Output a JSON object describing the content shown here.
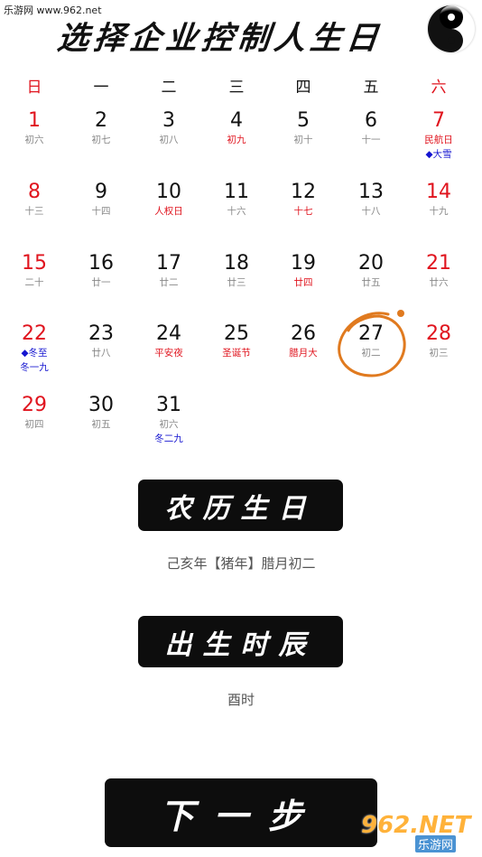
{
  "watermark_top": "乐游网 www.962.net",
  "title": "选择企业控制人生日",
  "weekdays": [
    {
      "label": "日",
      "color": "red"
    },
    {
      "label": "一",
      "color": "black"
    },
    {
      "label": "二",
      "color": "black"
    },
    {
      "label": "三",
      "color": "black"
    },
    {
      "label": "四",
      "color": "black"
    },
    {
      "label": "五",
      "color": "black"
    },
    {
      "label": "六",
      "color": "red"
    }
  ],
  "days": [
    {
      "day": "1",
      "lunar": "初六",
      "lunar_color": "gray",
      "weekend": true
    },
    {
      "day": "2",
      "lunar": "初七",
      "lunar_color": "gray"
    },
    {
      "day": "3",
      "lunar": "初八",
      "lunar_color": "gray"
    },
    {
      "day": "4",
      "lunar": "初九",
      "lunar_color": "red"
    },
    {
      "day": "5",
      "lunar": "初十",
      "lunar_color": "gray"
    },
    {
      "day": "6",
      "lunar": "十一",
      "lunar_color": "gray"
    },
    {
      "day": "7",
      "lunar": "民航日",
      "lunar_color": "red",
      "extra": "◆大雪",
      "extra_color": "blue",
      "weekend": true
    },
    {
      "day": "8",
      "lunar": "十三",
      "lunar_color": "gray",
      "weekend": true
    },
    {
      "day": "9",
      "lunar": "十四",
      "lunar_color": "gray"
    },
    {
      "day": "10",
      "lunar": "人权日",
      "lunar_color": "red"
    },
    {
      "day": "11",
      "lunar": "十六",
      "lunar_color": "gray"
    },
    {
      "day": "12",
      "lunar": "十七",
      "lunar_color": "red"
    },
    {
      "day": "13",
      "lunar": "十八",
      "lunar_color": "gray"
    },
    {
      "day": "14",
      "lunar": "十九",
      "lunar_color": "gray",
      "weekend": true
    },
    {
      "day": "15",
      "lunar": "二十",
      "lunar_color": "gray",
      "weekend": true
    },
    {
      "day": "16",
      "lunar": "廿一",
      "lunar_color": "gray"
    },
    {
      "day": "17",
      "lunar": "廿二",
      "lunar_color": "gray"
    },
    {
      "day": "18",
      "lunar": "廿三",
      "lunar_color": "gray"
    },
    {
      "day": "19",
      "lunar": "廿四",
      "lunar_color": "red"
    },
    {
      "day": "20",
      "lunar": "廿五",
      "lunar_color": "gray"
    },
    {
      "day": "21",
      "lunar": "廿六",
      "lunar_color": "gray",
      "weekend": true
    },
    {
      "day": "22",
      "lunar": "◆冬至",
      "lunar_color": "blue",
      "extra": "冬一九",
      "extra_color": "blue",
      "weekend": true
    },
    {
      "day": "23",
      "lunar": "廿八",
      "lunar_color": "gray"
    },
    {
      "day": "24",
      "lunar": "平安夜",
      "lunar_color": "red"
    },
    {
      "day": "25",
      "lunar": "圣诞节",
      "lunar_color": "red"
    },
    {
      "day": "26",
      "lunar": "腊月大",
      "lunar_color": "red"
    },
    {
      "day": "27",
      "lunar": "初二",
      "lunar_color": "gray",
      "selected": true
    },
    {
      "day": "28",
      "lunar": "初三",
      "lunar_color": "gray",
      "weekend": true
    },
    {
      "day": "29",
      "lunar": "初四",
      "lunar_color": "gray",
      "weekend": true
    },
    {
      "day": "30",
      "lunar": "初五",
      "lunar_color": "gray"
    },
    {
      "day": "31",
      "lunar": "初六",
      "lunar_color": "gray",
      "extra": "冬二九",
      "extra_color": "blue"
    }
  ],
  "lunar_button_label": "农历生日",
  "lunar_info": "己亥年【猪年】腊月初二",
  "hour_button_label": "出生时辰",
  "hour_info": "酉时",
  "next_button_label": "下一步",
  "watermark_bottom_big": "962.NET",
  "watermark_bottom_small": "乐游网",
  "colors": {
    "red": "#e0141e",
    "blue": "#1414d0",
    "gray": "#888888",
    "button": "#0d0d0d",
    "circle": "#e07a1f"
  }
}
